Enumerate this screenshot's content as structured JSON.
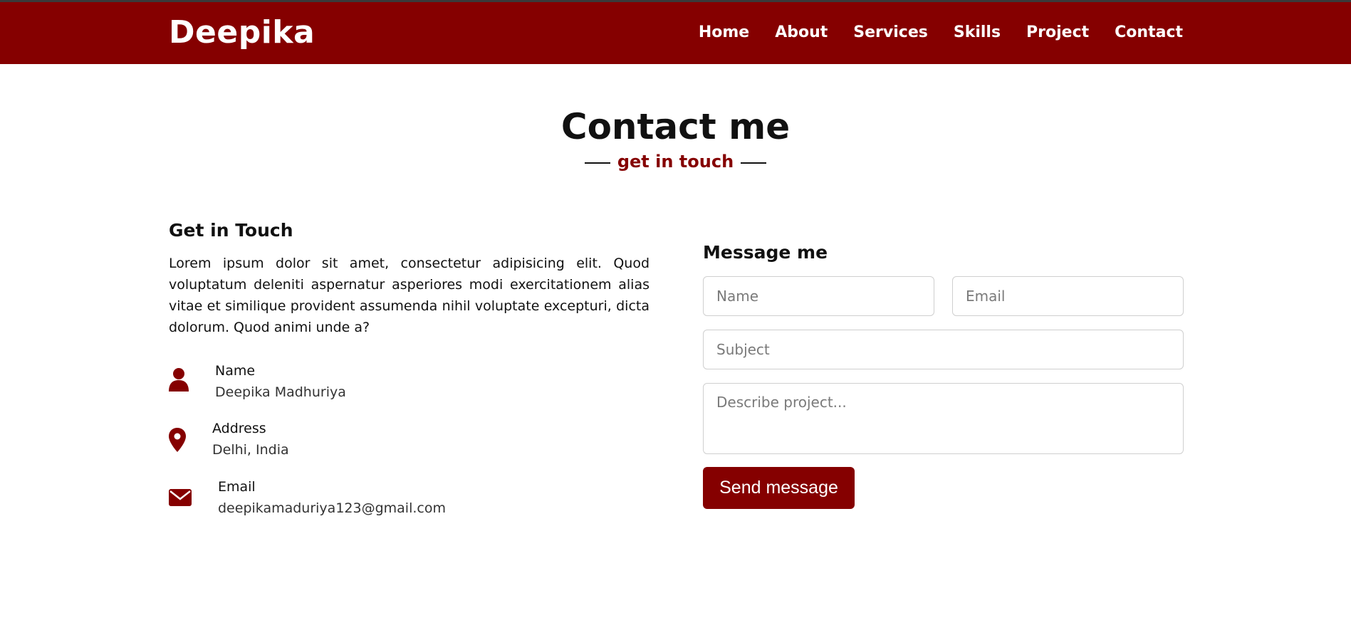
{
  "navbar": {
    "brand": "Deepika",
    "links": [
      "Home",
      "About",
      "Services",
      "Skills",
      "Project",
      "Contact"
    ]
  },
  "section": {
    "title": "Contact me",
    "subtitle": "get in touch"
  },
  "left": {
    "title": "Get in Touch",
    "paragraph": "Lorem ipsum dolor sit amet, consectetur adipisicing elit. Quod voluptatum deleniti aspernatur asperiores modi exercitationem alias vitae et similique provident assumenda nihil voluptate excepturi, dicta dolorum. Quod animi unde a?",
    "info": [
      {
        "icon": "user-icon",
        "head": "Name",
        "value": "Deepika Madhuriya"
      },
      {
        "icon": "map-marker-icon",
        "head": "Address",
        "value": "Delhi, India"
      },
      {
        "icon": "envelope-icon",
        "head": "Email",
        "value": "deepikamaduriya123@gmail.com"
      }
    ]
  },
  "form": {
    "title": "Message me",
    "name_placeholder": "Name",
    "email_placeholder": "Email",
    "subject_placeholder": "Subject",
    "message_placeholder": "Describe project...",
    "send_label": "Send message"
  },
  "colors": {
    "accent": "#850000",
    "background": "#ffffff",
    "text": "#111111"
  }
}
